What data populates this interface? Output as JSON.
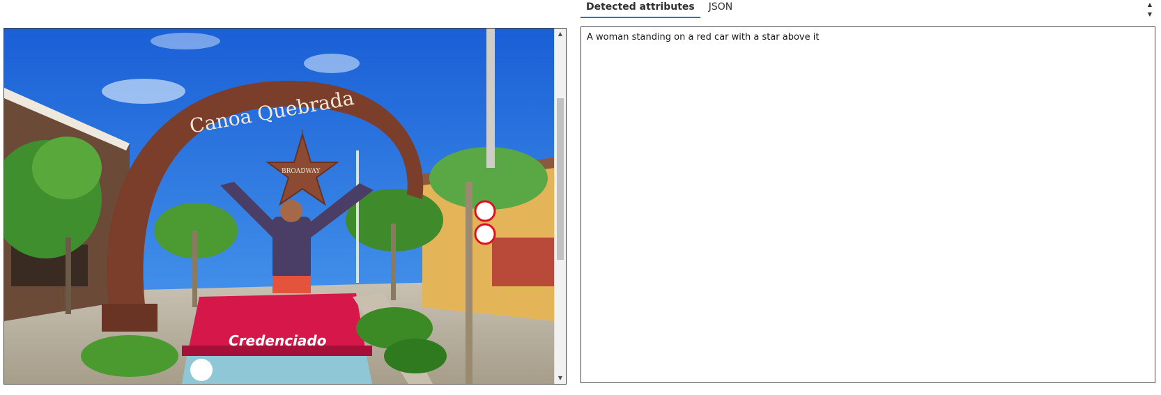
{
  "tabs": [
    {
      "label": "Detected attributes",
      "active": true
    },
    {
      "label": "JSON",
      "active": false
    }
  ],
  "image": {
    "arch_text": "Canoa Quebrada",
    "star_text": "BROADWAY",
    "vehicle_text": "Credenciado"
  },
  "result": {
    "caption": "A woman standing on a red car with a star above it"
  },
  "colors": {
    "accent": "#0078d4",
    "sky": "#1f6fe0",
    "arch": "#7a3e2a",
    "car": "#d6174a"
  }
}
